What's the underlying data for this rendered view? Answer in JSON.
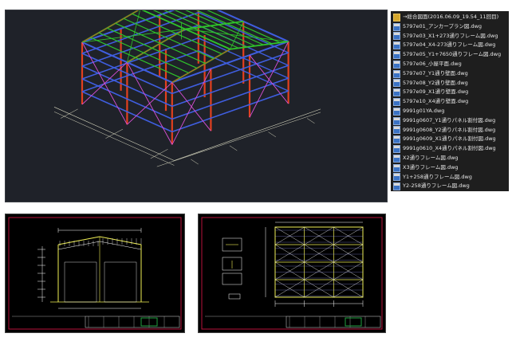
{
  "file_list": {
    "items": [
      {
        "label": "→総合図面(2016.06.09_19.54_11回目)",
        "icon": "folder-icon"
      },
      {
        "label": "5797e01_アンカープラン図.dwg",
        "icon": "dwg-file-icon"
      },
      {
        "label": "5797e03_X1+273通りフレーム図.dwg",
        "icon": "dwg-file-icon"
      },
      {
        "label": "5797e04_X4-273通りフレーム図.dwg",
        "icon": "dwg-file-icon"
      },
      {
        "label": "5797e05_Y1+7650通りフレーム図.dwg",
        "icon": "dwg-file-icon"
      },
      {
        "label": "5797e06_小屋平面.dwg",
        "icon": "dwg-file-icon"
      },
      {
        "label": "5797e07_Y1通り壁面.dwg",
        "icon": "dwg-file-icon"
      },
      {
        "label": "5797e08_Y2通り壁面.dwg",
        "icon": "dwg-file-icon"
      },
      {
        "label": "5797e09_X1通り壁面.dwg",
        "icon": "dwg-file-icon"
      },
      {
        "label": "5797e10_X4通り壁面.dwg",
        "icon": "dwg-file-icon"
      },
      {
        "label": "9991g01YA.dwg",
        "icon": "dwg-file-icon"
      },
      {
        "label": "9991g0607_Y1通りパネル割付図.dwg",
        "icon": "dwg-file-icon"
      },
      {
        "label": "9991g0608_Y2通りパネル割付図.dwg",
        "icon": "dwg-file-icon"
      },
      {
        "label": "9991g0609_X1通りパネル割付図.dwg",
        "icon": "dwg-file-icon"
      },
      {
        "label": "9991g0610_X4通りパネル割付図.dwg",
        "icon": "dwg-file-icon"
      },
      {
        "label": "X2通りフレーム図.dwg",
        "icon": "dwg-file-icon"
      },
      {
        "label": "X3通りフレーム図.dwg",
        "icon": "dwg-file-icon"
      },
      {
        "label": "Y1+258通りフレーム図.dwg",
        "icon": "dwg-file-icon"
      },
      {
        "label": "Y2-258通りフレーム図.dwg",
        "icon": "dwg-file-icon"
      }
    ]
  },
  "colors": {
    "model_background": "#1f2229",
    "column": "#e2401f",
    "beam": "#3f5ee0",
    "roof": "#2fc42a",
    "brace": "#d94fd6",
    "dimension": "#d8d8c0",
    "drawing_line": "#f0ef55",
    "drawing_frame": "#b8123a",
    "titleblock": "#20a040"
  }
}
